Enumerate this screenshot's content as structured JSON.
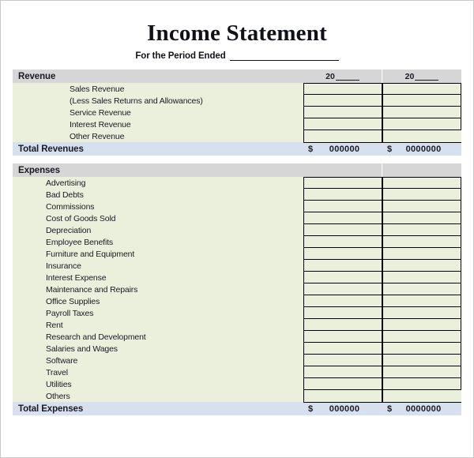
{
  "document": {
    "title": "Income Statement",
    "period_label": "For the Period Ended",
    "period_value": ""
  },
  "columns": {
    "year_prefix": "20",
    "col1_year": "",
    "col2_year": ""
  },
  "sections": [
    {
      "id": "revenue",
      "header": "Revenue",
      "items": [
        {
          "label": "Sales Revenue",
          "col1": "",
          "col2": ""
        },
        {
          "label": "(Less Sales Returns and Allowances)",
          "col1": "",
          "col2": ""
        },
        {
          "label": "Service Revenue",
          "col1": "",
          "col2": ""
        },
        {
          "label": "Interest Revenue",
          "col1": "",
          "col2": ""
        },
        {
          "label": "Other Revenue",
          "col1": "",
          "col2": ""
        }
      ],
      "total": {
        "label": "Total Revenues",
        "currency": "$",
        "col1": "000000",
        "col2": "0000000"
      }
    },
    {
      "id": "expenses",
      "header": "Expenses",
      "items": [
        {
          "label": "Advertising",
          "col1": "",
          "col2": ""
        },
        {
          "label": "Bad Debts",
          "col1": "",
          "col2": ""
        },
        {
          "label": "Commissions",
          "col1": "",
          "col2": ""
        },
        {
          "label": "Cost of Goods Sold",
          "col1": "",
          "col2": ""
        },
        {
          "label": "Depreciation",
          "col1": "",
          "col2": ""
        },
        {
          "label": "Employee Benefits",
          "col1": "",
          "col2": ""
        },
        {
          "label": "Furniture and Equipment",
          "col1": "",
          "col2": ""
        },
        {
          "label": "Insurance",
          "col1": "",
          "col2": ""
        },
        {
          "label": "Interest Expense",
          "col1": "",
          "col2": ""
        },
        {
          "label": "Maintenance and Repairs",
          "col1": "",
          "col2": ""
        },
        {
          "label": "Office Supplies",
          "col1": "",
          "col2": ""
        },
        {
          "label": "Payroll Taxes",
          "col1": "",
          "col2": ""
        },
        {
          "label": "Rent",
          "col1": "",
          "col2": ""
        },
        {
          "label": "Research and Development",
          "col1": "",
          "col2": ""
        },
        {
          "label": "Salaries and Wages",
          "col1": "",
          "col2": ""
        },
        {
          "label": "Software",
          "col1": "",
          "col2": ""
        },
        {
          "label": "Travel",
          "col1": "",
          "col2": ""
        },
        {
          "label": "Utilities",
          "col1": "",
          "col2": ""
        },
        {
          "label": "Others",
          "col1": "",
          "col2": ""
        }
      ],
      "total": {
        "label": "Total Expenses",
        "currency": "$",
        "col1": "000000",
        "col2": "0000000"
      }
    }
  ],
  "colors": {
    "section_header_bg": "#D6D6D6",
    "item_row_bg": "#EBF0DC",
    "total_row_bg": "#D6E0EE",
    "text": "#1A1A24",
    "page_border": "#C9C9C9"
  }
}
